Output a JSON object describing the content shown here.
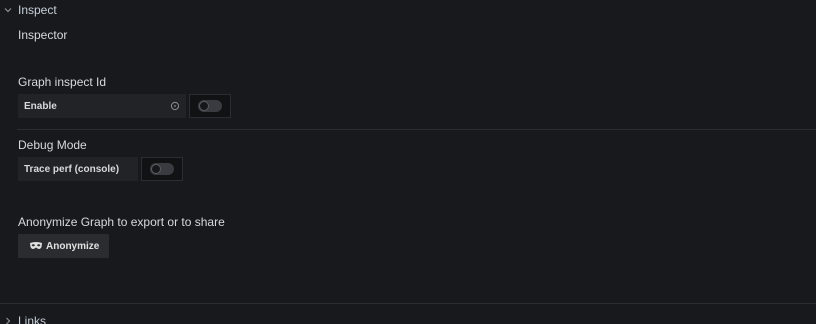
{
  "inspect": {
    "section_title": "Inspect",
    "subtitle": "Inspector",
    "graph_inspect": {
      "label": "Graph inspect Id",
      "field_label": "Enable",
      "toggle_on": false
    },
    "debug": {
      "label": "Debug Mode",
      "field_label": "Trace perf (console)",
      "toggle_on": false
    },
    "anonymize": {
      "label": "Anonymize Graph to export or to share",
      "button_label": "Anonymize"
    }
  },
  "links": {
    "section_title": "Links"
  },
  "icons": {
    "expand": "chevron-down-icon",
    "collapse": "chevron-right-icon",
    "info": "info-circle-icon",
    "anonymize": "mask-icon"
  },
  "colors": {
    "background": "#18191d",
    "field_background": "#222327",
    "button_background": "#2b2c30",
    "divider": "#2c2d31"
  }
}
